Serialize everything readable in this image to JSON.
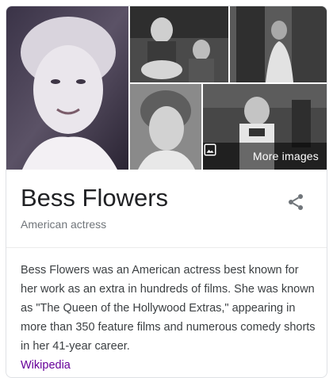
{
  "images": {
    "main_alt": "Bess Flowers portrait",
    "thumb1_alt": "Bess Flowers film still",
    "thumb2_alt": "Bess Flowers film still",
    "thumb3_alt": "Bess Flowers portrait",
    "thumb4_alt": "Bess Flowers film still",
    "more_label": "More images"
  },
  "entity": {
    "title": "Bess Flowers",
    "subtitle": "American actress",
    "share_icon": "share-icon"
  },
  "description": {
    "text": "Bess Flowers was an American actress best known for her work as an extra in hundreds of films. She was known as \"The Queen of the Hollywood Extras,\" appearing in more than 350 feature films and numerous comedy shorts in her 41-year career.",
    "source_link": "Wikipedia"
  },
  "colors": {
    "title": "#202124",
    "subtitle": "#70757a",
    "body_text": "#3c4043",
    "link": "#660099",
    "share_icon": "#70757a"
  }
}
